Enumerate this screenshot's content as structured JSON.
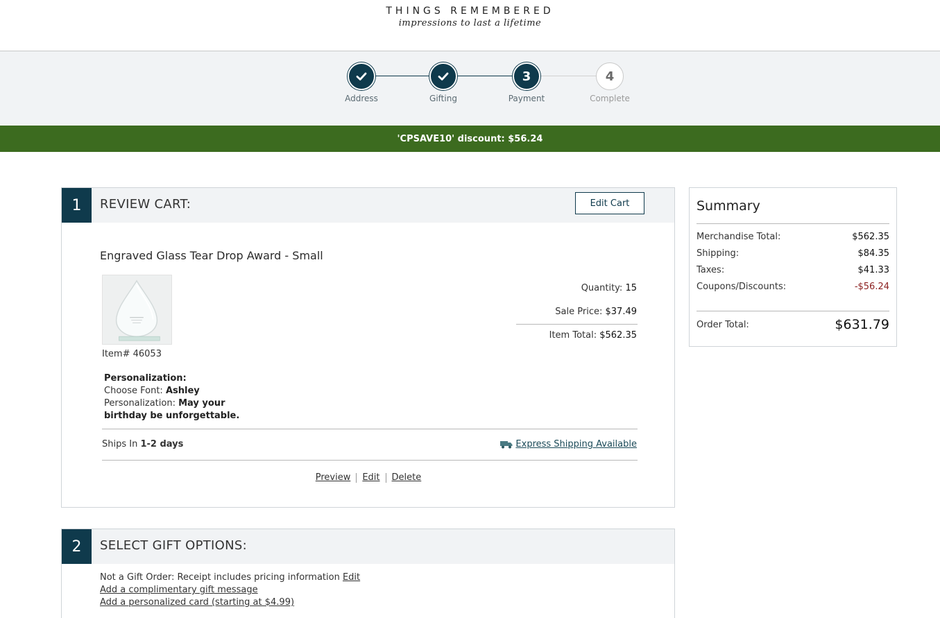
{
  "header": {
    "brand": "THINGS REMEMBERED",
    "tagline": "impressions to last a lifetime"
  },
  "steps": [
    {
      "label": "Address",
      "number": "1",
      "state": "done"
    },
    {
      "label": "Gifting",
      "number": "2",
      "state": "done"
    },
    {
      "label": "Payment",
      "number": "3",
      "state": "active"
    },
    {
      "label": "Complete",
      "number": "4",
      "state": "todo"
    }
  ],
  "promo": {
    "text": "'CPSAVE10' discount: $56.24"
  },
  "review": {
    "number": "1",
    "title": "REVIEW CART:",
    "edit_cart_label": "Edit Cart",
    "product": {
      "name": "Engraved Glass Tear Drop Award - Small",
      "item_label": "Item# 46053",
      "quantity_label": "Quantity:",
      "quantity": "15",
      "sale_price_label": "Sale Price:",
      "sale_price": "$37.49",
      "item_total_label": "Item Total:",
      "item_total": "$562.35",
      "personalization_heading": "Personalization:",
      "font_label": "Choose Font:",
      "font_value": "Ashley",
      "pers_label": "Personalization:",
      "pers_value": "May your birthday be unforgettable.",
      "ships_label": "Ships In",
      "ships_value": "1-2 days",
      "express_label": "Express Shipping Available"
    },
    "actions": {
      "preview": "Preview",
      "edit": "Edit",
      "delete": "Delete"
    }
  },
  "gift": {
    "number": "2",
    "title": "SELECT GIFT OPTIONS:",
    "not_gift_text": "Not a Gift Order: Receipt includes pricing information",
    "not_gift_edit": "Edit",
    "gift_message_link": "Add a complimentary gift message",
    "personalized_card_link": "Add a personalized card (starting at $4.99)"
  },
  "summary": {
    "title": "Summary",
    "rows": [
      {
        "label": "Merchandise Total:",
        "value": "$562.35"
      },
      {
        "label": "Shipping:",
        "value": "$84.35"
      },
      {
        "label": "Taxes:",
        "value": "$41.33"
      },
      {
        "label": "Coupons/Discounts:",
        "value": "-$56.24"
      }
    ],
    "total_label": "Order Total:",
    "total_value": "$631.79"
  },
  "colors": {
    "primary": "#0f3a4c",
    "promo_green": "#3c6b1f",
    "discount_red": "#8b1e1e"
  }
}
